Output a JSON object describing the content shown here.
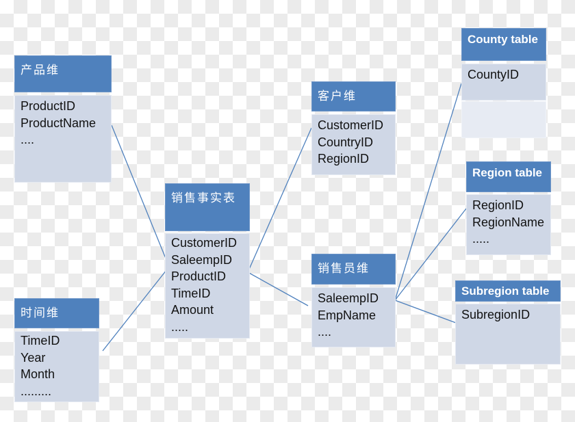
{
  "colors": {
    "header": "#4f81bd",
    "body": "#cfd7e6",
    "line": "#4f81bd"
  },
  "tables": {
    "product": {
      "title": "产品维",
      "fields": [
        "ProductID",
        "ProductName",
        "...."
      ]
    },
    "time": {
      "title": "时间维",
      "fields": [
        "TimeID",
        "Year",
        "Month",
        "........."
      ]
    },
    "fact": {
      "title": "销售事实表",
      "fields": [
        "CustomerID",
        "SaleempID",
        "ProductID",
        "TimeID",
        "Amount",
        "....."
      ]
    },
    "customer": {
      "title": "客户维",
      "fields": [
        "CustomerID",
        "CountryID",
        "RegionID"
      ]
    },
    "salesperson": {
      "title": "销售员维",
      "fields": [
        "SaleempID",
        "EmpName",
        "...."
      ]
    },
    "county": {
      "title": "County table",
      "fields": [
        "CountyID"
      ]
    },
    "region": {
      "title": "Region table",
      "fields": [
        "RegionID",
        "RegionName",
        "....."
      ]
    },
    "subregion": {
      "title": "Subregion table",
      "fields": [
        "SubregionID"
      ]
    }
  },
  "links": [
    {
      "from": "product",
      "to": "fact"
    },
    {
      "from": "time",
      "to": "fact"
    },
    {
      "from": "fact",
      "to": "customer"
    },
    {
      "from": "fact",
      "to": "salesperson"
    },
    {
      "from": "salesperson",
      "to": "county"
    },
    {
      "from": "salesperson",
      "to": "region"
    },
    {
      "from": "salesperson",
      "to": "subregion"
    }
  ]
}
